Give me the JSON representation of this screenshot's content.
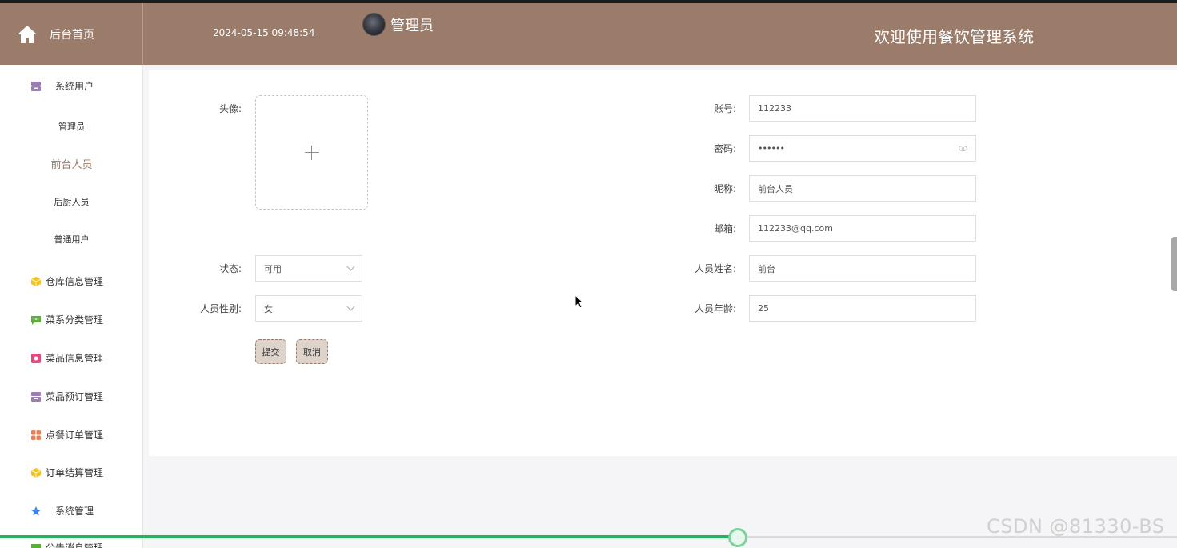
{
  "header": {
    "home_label": "后台首页",
    "datetime": "2024-05-15 09:48:54",
    "username": "管理员",
    "welcome": "欢迎使用餐饮管理系统"
  },
  "sidebar": {
    "groups": [
      {
        "label": "系统用户",
        "icon": "user-group-icon",
        "color": "#9b7fb3"
      },
      {
        "label": "仓库信息管理",
        "icon": "cube-icon",
        "color": "#f3c21b"
      },
      {
        "label": "菜系分类管理",
        "icon": "message-icon",
        "color": "#5cae3c"
      },
      {
        "label": "菜品信息管理",
        "icon": "dish-icon",
        "color": "#e5477f"
      },
      {
        "label": "菜品预订管理",
        "icon": "calendar-icon",
        "color": "#9b7fb3"
      },
      {
        "label": "点餐订单管理",
        "icon": "grid-icon",
        "color": "#ef7d53"
      },
      {
        "label": "订单结算管理",
        "icon": "cube-icon",
        "color": "#f3c21b"
      },
      {
        "label": "系统管理",
        "icon": "star-icon",
        "color": "#3b82f6"
      },
      {
        "label": "公告消息管理",
        "icon": "message-icon",
        "color": "#5cae3c"
      }
    ],
    "sub_items": [
      "管理员",
      "前台人员",
      "后厨人员",
      "普通用户"
    ],
    "active_sub": "前台人员"
  },
  "form": {
    "avatar_label": "头像:",
    "status_label": "状态:",
    "status_value": "可用",
    "gender_label": "人员性别:",
    "gender_value": "女",
    "account_label": "账号:",
    "account_value": "112233",
    "password_label": "密码:",
    "password_value": "••••••",
    "nickname_label": "昵称:",
    "nickname_value": "前台人员",
    "email_label": "邮箱:",
    "email_value": "112233@qq.com",
    "name_label": "人员姓名:",
    "name_value": "前台",
    "age_label": "人员年龄:",
    "age_value": "25",
    "submit_label": "提交",
    "cancel_label": "取消"
  },
  "progress": {
    "fraction": 0.627
  },
  "watermark": "CSDN @81330-BS"
}
